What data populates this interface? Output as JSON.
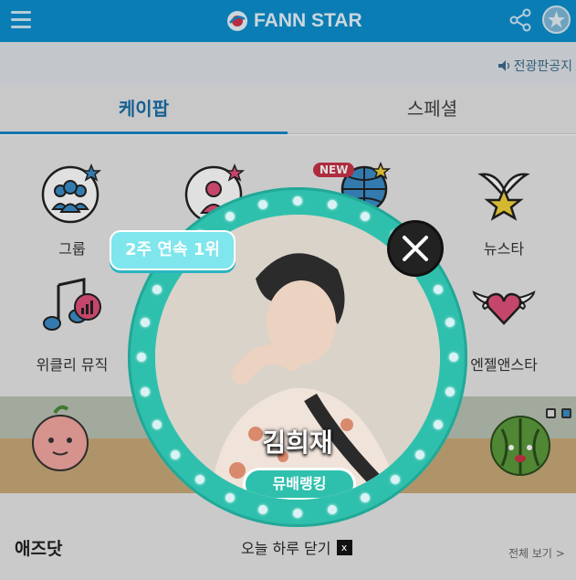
{
  "header": {
    "logo_text": "FANN STAR",
    "menu_icon": "hamburger-icon",
    "share_icon": "share-icon",
    "favorite_icon": "star-icon"
  },
  "notice": {
    "label": "전광판공지",
    "icon": "speaker-icon"
  },
  "tabs": [
    {
      "label": "케이팝",
      "active": true
    },
    {
      "label": "스페셜",
      "active": false
    }
  ],
  "categories": [
    {
      "label": "그룹",
      "icon": "group-icon"
    },
    {
      "label": "",
      "icon": "solo-icon"
    },
    {
      "label": "",
      "icon": "globe-icon",
      "badge": "NEW"
    },
    {
      "label": "뉴스타",
      "icon": "new-star-icon"
    },
    {
      "label": "위클리 뮤직",
      "icon": "weekly-music-icon"
    },
    {
      "label": "엔젤앤스타",
      "icon": "angel-heart-icon"
    }
  ],
  "banner": {
    "dots": 2,
    "active_dot": 1
  },
  "section": {
    "title": "애즈닷",
    "see_all": "전체 보기 >"
  },
  "popup": {
    "rank_badge": "2주 연속 1위",
    "name": "김희재",
    "pill": "뮤배랭킹",
    "close_icon": "close-icon",
    "today_close": "오늘 하루 닫기",
    "today_close_x": "x"
  },
  "colors": {
    "header_bg": "#0d8fcf",
    "ring": "#2ec0ad",
    "accent": "#1a86c8",
    "new_badge": "#c83346"
  }
}
